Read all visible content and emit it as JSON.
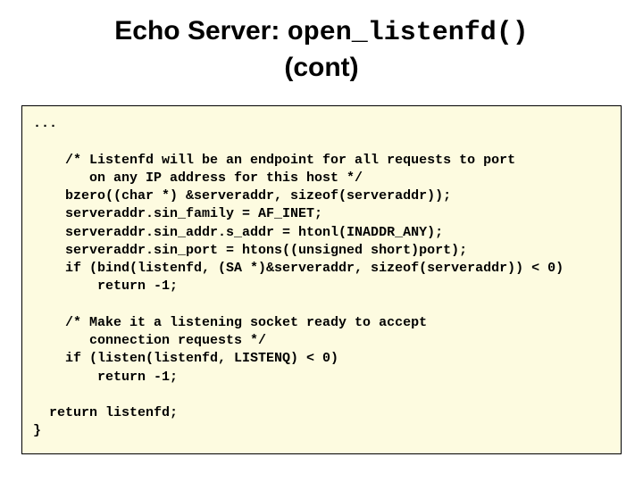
{
  "title": {
    "prefix": "Echo Server: ",
    "func": "open_listenfd()",
    "suffix": "(cont)"
  },
  "code": "...\n\n    /* Listenfd will be an endpoint for all requests to port\n       on any IP address for this host */\n    bzero((char *) &serveraddr, sizeof(serveraddr));\n    serveraddr.sin_family = AF_INET;\n    serveraddr.sin_addr.s_addr = htonl(INADDR_ANY);\n    serveraddr.sin_port = htons((unsigned short)port);\n    if (bind(listenfd, (SA *)&serveraddr, sizeof(serveraddr)) < 0)\n        return -1;\n\n    /* Make it a listening socket ready to accept\n       connection requests */\n    if (listen(listenfd, LISTENQ) < 0)\n        return -1;\n\n  return listenfd;\n}"
}
